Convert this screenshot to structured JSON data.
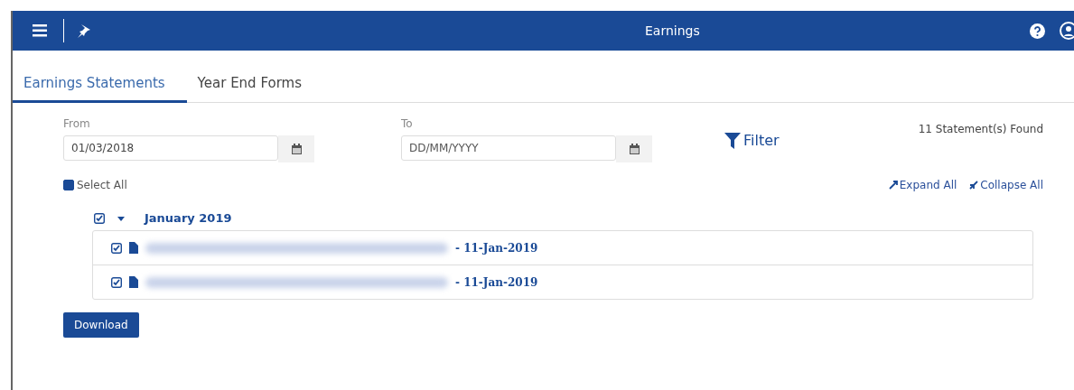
{
  "header": {
    "title": "Earnings"
  },
  "tabs": [
    {
      "label": "Earnings Statements",
      "selected": true
    },
    {
      "label": "Year End Forms",
      "selected": false
    }
  ],
  "filters": {
    "from": {
      "label": "From",
      "value": "01/03/2018"
    },
    "to": {
      "label": "To",
      "placeholder": "DD/MM/YYYY"
    },
    "filter_label": "Filter",
    "found": "11 Statement(s) Found"
  },
  "select_all": {
    "label": "Select All",
    "checked": true
  },
  "expand_all": "Expand All",
  "collapse_all": "Collapse All",
  "groups": [
    {
      "label": "January 2019",
      "checked": true,
      "expanded": true,
      "statements": [
        {
          "date": "- 11-Jan-2019",
          "checked": true
        },
        {
          "date": "- 11-Jan-2019",
          "checked": true
        }
      ]
    }
  ],
  "download": "Download"
}
